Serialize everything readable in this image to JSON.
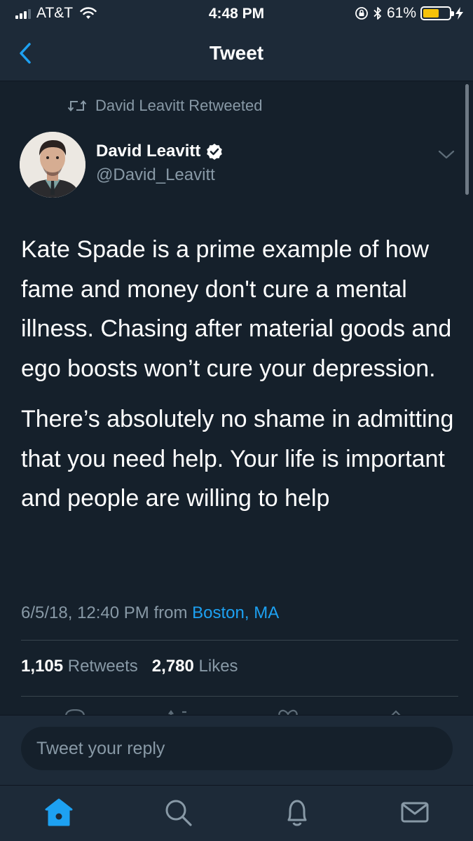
{
  "status_bar": {
    "carrier": "AT&T",
    "time": "4:48 PM",
    "battery_percent": "61%",
    "battery_level": 0.61,
    "signal_bars": 4,
    "signal_bars_filled": 3,
    "battery_color": "#f5c20a"
  },
  "nav": {
    "title": "Tweet",
    "back_icon": "chevron-left-icon"
  },
  "tweet": {
    "retweeted_by": "David Leavitt Retweeted",
    "author_name": "David Leavitt",
    "author_handle": "@David_Leavitt",
    "paragraphs": [
      "Kate Spade is a prime example of how fame and money don't cure a mental illness. Chasing after material goods and ego boosts won’t cure your depression.",
      "There’s absolutely no shame in admitting that you need help. Your life is important and people are willing to help"
    ],
    "timestamp": "6/5/18, 12:40 PM",
    "from_label": "from",
    "location": "Boston, MA",
    "retweets_count": "1,105",
    "retweets_label": "Retweets",
    "likes_count": "2,780",
    "likes_label": "Likes"
  },
  "reply": {
    "placeholder": "Tweet your reply"
  },
  "tabbar": {
    "items": [
      "home-icon",
      "search-icon",
      "bell-icon",
      "mail-icon"
    ]
  },
  "colors": {
    "background": "#15202b",
    "bar_background": "#1d2a38",
    "accent": "#1da1f2",
    "secondary_text": "#8899a6"
  }
}
